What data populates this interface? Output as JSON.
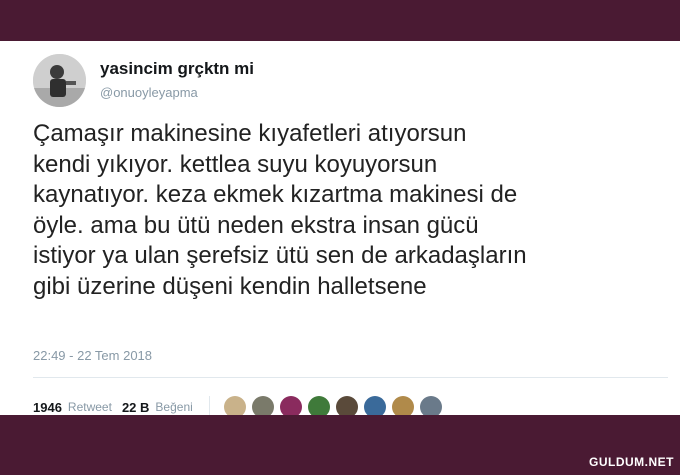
{
  "tweet": {
    "display_name": "yasincim grçktn mi",
    "handle": "@onuoyleyapma",
    "text": "Çamaşır makinesine kıyafetleri atıyorsun\nkendi yıkıyor. kettlea suyu koyuyorsun\nkaynatıyor. keza ekmek kızartma makinesi de\nöyle. ama bu ütü neden ekstra insan gücü\nistiyor ya ulan şerefsiz ütü sen de arkadaşların\ngibi üzerine düşeni kendin halletsene",
    "timestamp": "22:49 - 22 Tem 2018",
    "retweets_count": "1946",
    "retweets_label": "Retweet",
    "likes_count": "22 B",
    "likes_label": "Beğeni",
    "liker_colors": [
      "#c9b28a",
      "#7a7a6a",
      "#8a2b5e",
      "#3f7a3a",
      "#5a4a3a",
      "#3a6a9a",
      "#b08a4a",
      "#6a7a8a"
    ]
  },
  "watermark": "GULDUM.NET"
}
